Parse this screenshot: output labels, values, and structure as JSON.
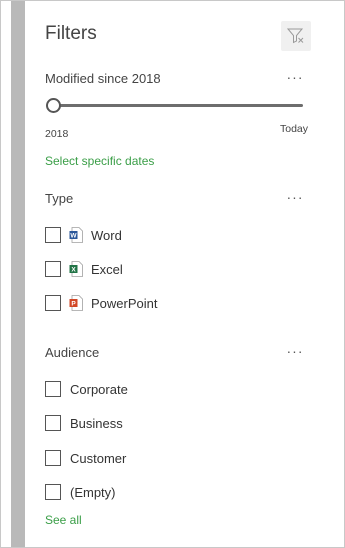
{
  "panel": {
    "title": "Filters",
    "clear_icon": "filter-clear-icon"
  },
  "modified": {
    "header": "Modified since 2018",
    "more_label": "···",
    "slider": {
      "min_label": "2018",
      "max_label": "Today",
      "value_fraction": 0.0
    },
    "specific_dates_link": "Select specific dates"
  },
  "type": {
    "header": "Type",
    "more_label": "···",
    "items": [
      {
        "label": "Word",
        "icon": "word-icon",
        "color": "#2b579a",
        "checked": false
      },
      {
        "label": "Excel",
        "icon": "excel-icon",
        "color": "#217346",
        "checked": false
      },
      {
        "label": "PowerPoint",
        "icon": "powerpoint-icon",
        "color": "#d24726",
        "checked": false
      }
    ]
  },
  "audience": {
    "header": "Audience",
    "more_label": "···",
    "items": [
      {
        "label": "Corporate",
        "checked": false
      },
      {
        "label": "Business",
        "checked": false
      },
      {
        "label": "Customer",
        "checked": false
      },
      {
        "label": "(Empty)",
        "checked": false
      }
    ],
    "see_all_link": "See all"
  },
  "colors": {
    "link": "#3a9e47",
    "rail": "#b9b9b9",
    "text": "#444444"
  }
}
